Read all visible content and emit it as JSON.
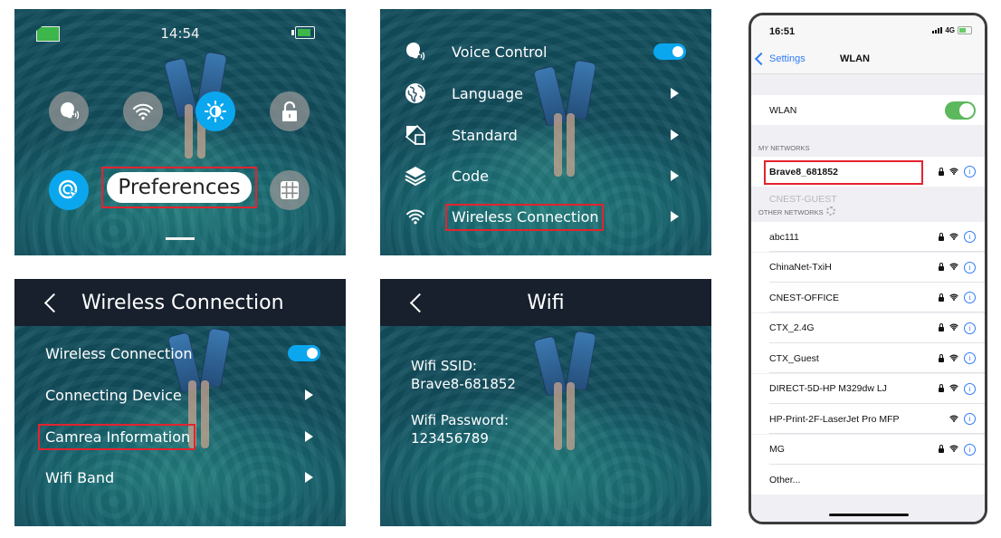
{
  "panel1": {
    "time": "14:54",
    "battery_level_pct": 85,
    "icons": [
      "voice-control-icon",
      "wifi-icon",
      "brightness-icon",
      "lock-icon",
      "screen-saver-icon",
      "grid-icon"
    ],
    "selected_label": "Preferences"
  },
  "panel2": {
    "items": [
      {
        "label": "Voice Control",
        "icon": "voice-icon",
        "control": "toggle",
        "on": true
      },
      {
        "label": "Language",
        "icon": "globe-icon",
        "control": "arrow"
      },
      {
        "label": "Standard",
        "icon": "standard-icon",
        "control": "arrow"
      },
      {
        "label": "Code",
        "icon": "layers-icon",
        "control": "arrow"
      },
      {
        "label": "Wireless Connection",
        "icon": "wifi-icon",
        "control": "arrow",
        "highlighted": true
      }
    ]
  },
  "panel3": {
    "title": "Wireless Connection",
    "items": [
      {
        "label": "Wireless Connection",
        "control": "toggle",
        "on": true
      },
      {
        "label": "Connecting Device",
        "control": "arrow"
      },
      {
        "label": "Camrea Information",
        "control": "arrow",
        "highlighted": true
      },
      {
        "label": "Wifi Band",
        "control": "arrow"
      }
    ]
  },
  "panel4": {
    "title": "Wifi",
    "ssid_label": "Wifi SSID:",
    "ssid_value": "Brave8-681852",
    "password_label": "Wifi Password:",
    "password_value": "123456789"
  },
  "phone": {
    "time": "16:51",
    "network": "4G",
    "back_label": "Settings",
    "title": "WLAN",
    "wlan_label": "WLAN",
    "wlan_on": true,
    "my_networks_header": "MY NETWORKS",
    "my_networks": [
      {
        "name": "Brave8_681852",
        "locked": true,
        "highlighted": true
      }
    ],
    "ghost_network": "CNEST-GUEST",
    "other_networks_header": "OTHER NETWORKS",
    "other_networks": [
      {
        "name": "abc111",
        "locked": true
      },
      {
        "name": "ChinaNet-TxiH",
        "locked": true
      },
      {
        "name": "CNEST-OFFICE",
        "locked": true
      },
      {
        "name": "CTX_2.4G",
        "locked": true
      },
      {
        "name": "CTX_Guest",
        "locked": true
      },
      {
        "name": "DIRECT-5D-HP M329dw LJ",
        "locked": true
      },
      {
        "name": "HP-Print-2F-LaserJet Pro MFP",
        "locked": false
      },
      {
        "name": "MG",
        "locked": true
      }
    ],
    "other_label": "Other...",
    "info_glyph": "i"
  },
  "colors": {
    "accent_blue": "#0aa7ef",
    "highlight_red": "#e4232e",
    "ios_green": "#5cb85c",
    "ios_link": "#2f7cf6"
  }
}
